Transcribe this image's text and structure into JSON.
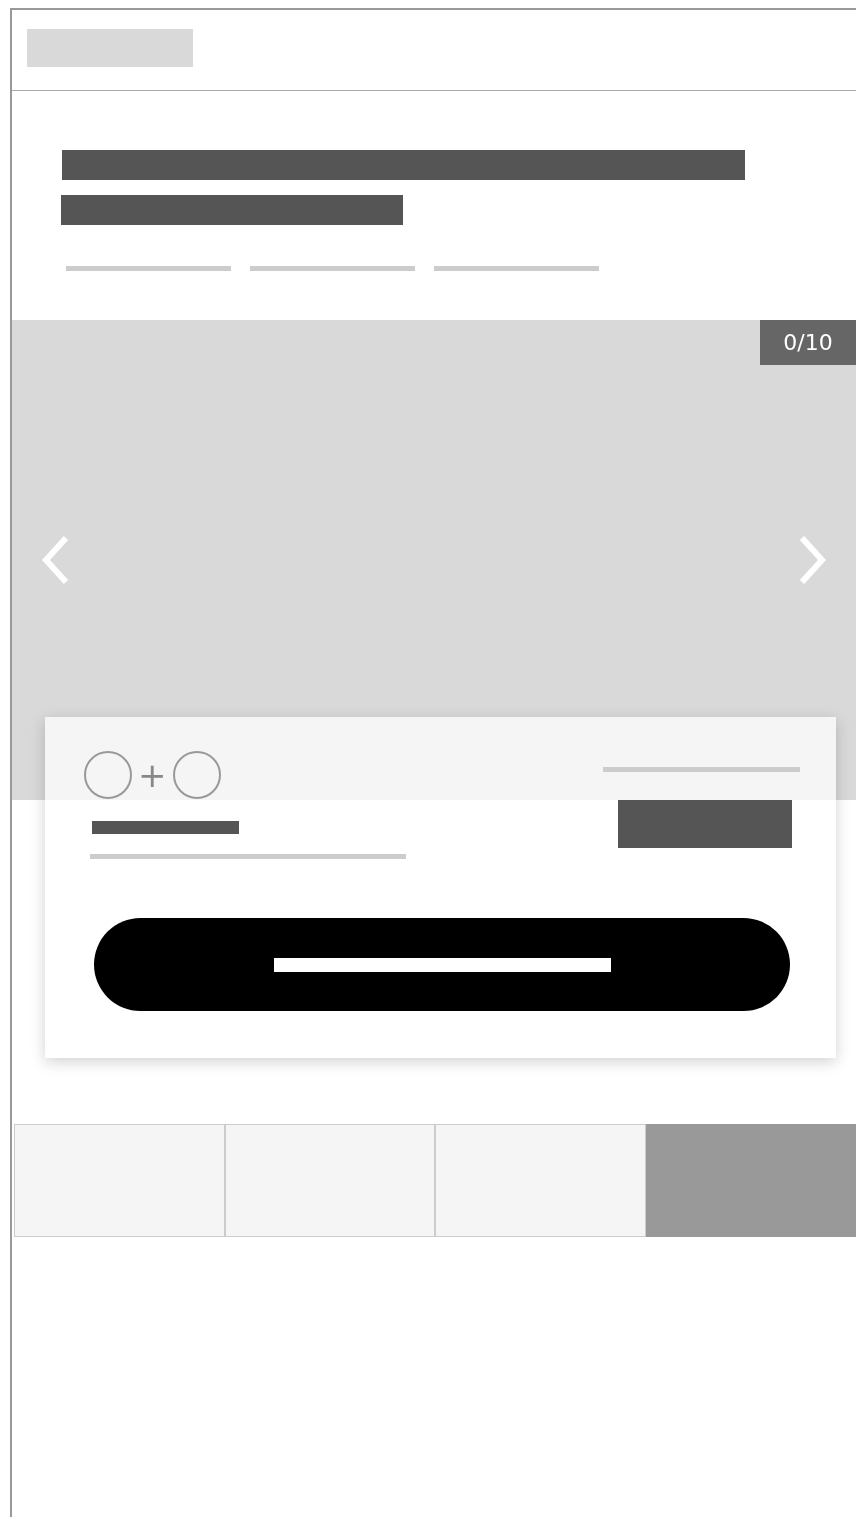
{
  "gallery": {
    "counter": "0/10"
  },
  "bundle": {
    "plus": "+"
  },
  "tabs": [
    {
      "selected": false
    },
    {
      "selected": false
    },
    {
      "selected": false
    },
    {
      "selected": true
    }
  ]
}
